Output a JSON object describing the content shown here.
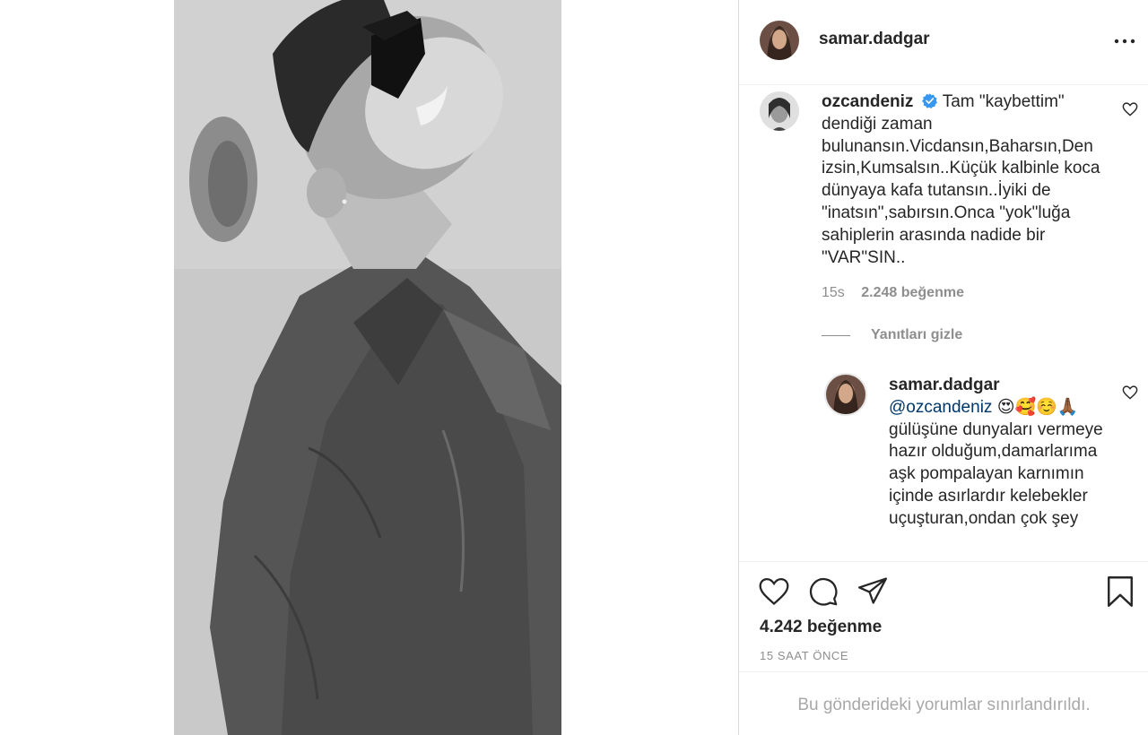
{
  "post": {
    "author": "samar.dadgar"
  },
  "comment": {
    "username": "ozcandeniz",
    "text": "Tam \"kaybettim\" dendiği zaman bulunansın.Vicdansın,Baharsın,Den izsin,Kumsalsın..Küçük kalbinle koca dünyaya kafa tutansın..İyiki de \"inatsın\",sabırsın.Onca \"yok\"luğa sahiplerin arasında nadide bir \"VAR\"SIN..",
    "time": "15s",
    "likes": "2.248 beğenme",
    "hide_replies": "Yanıtları gizle"
  },
  "reply": {
    "username": "samar.dadgar",
    "mention": "@ozcandeniz",
    "emojis": "😍🥰☺️🙏🏾",
    "text": "gülüşüne dunyaları vermeye hazır olduğum,damarlarıma aşk pompalayan karnımın içinde asırlardır kelebekler uçuşturan,ondan çok şey"
  },
  "actions": {
    "likes_total": "4.242 beğenme",
    "time_ago": "15 SAAT ÖNCE"
  },
  "footer": {
    "restricted_notice": "Bu gönderideki yorumlar sınırlandırıldı."
  },
  "icons": [
    "more-icon",
    "verified-icon",
    "heart-icon",
    "comment-icon",
    "share-icon",
    "bookmark-icon"
  ]
}
